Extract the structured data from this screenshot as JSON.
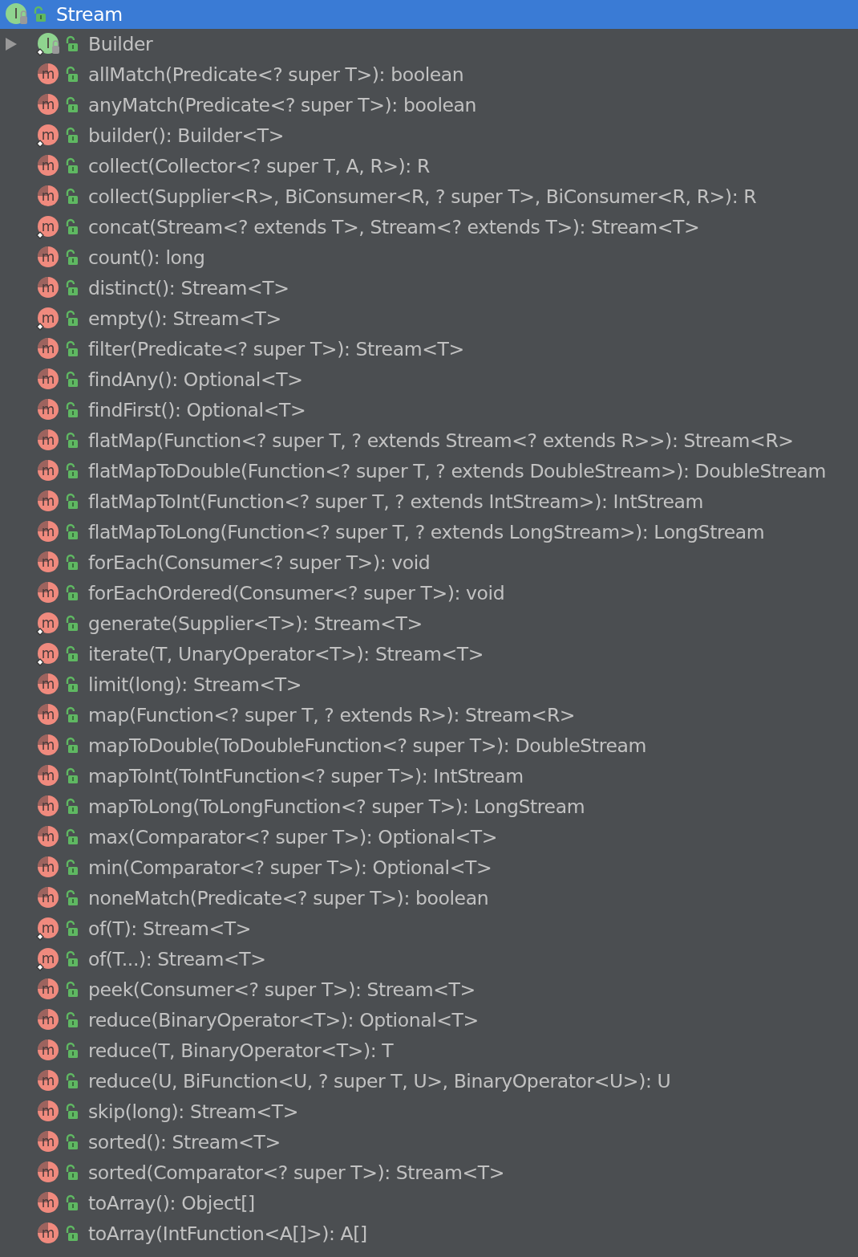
{
  "tree": {
    "label": "Stream",
    "kind": "interface",
    "icon_letter": "I",
    "static": false,
    "abstract": false,
    "selected": true,
    "children": [
      {
        "label": "Builder",
        "kind": "interface",
        "icon_letter": "I",
        "static": true,
        "abstract": false,
        "selected": false,
        "expanded": false
      },
      {
        "label": "allMatch(Predicate<? super T>): boolean",
        "kind": "method",
        "icon_letter": "m",
        "static": false,
        "abstract": true,
        "selected": false
      },
      {
        "label": "anyMatch(Predicate<? super T>): boolean",
        "kind": "method",
        "icon_letter": "m",
        "static": false,
        "abstract": true,
        "selected": false
      },
      {
        "label": "builder(): Builder<T>",
        "kind": "method",
        "icon_letter": "m",
        "static": true,
        "abstract": false,
        "selected": false
      },
      {
        "label": "collect(Collector<? super T, A, R>): R",
        "kind": "method",
        "icon_letter": "m",
        "static": false,
        "abstract": true,
        "selected": false
      },
      {
        "label": "collect(Supplier<R>, BiConsumer<R, ? super T>, BiConsumer<R, R>): R",
        "kind": "method",
        "icon_letter": "m",
        "static": false,
        "abstract": true,
        "selected": false
      },
      {
        "label": "concat(Stream<? extends T>, Stream<? extends T>): Stream<T>",
        "kind": "method",
        "icon_letter": "m",
        "static": true,
        "abstract": false,
        "selected": false
      },
      {
        "label": "count(): long",
        "kind": "method",
        "icon_letter": "m",
        "static": false,
        "abstract": true,
        "selected": false
      },
      {
        "label": "distinct(): Stream<T>",
        "kind": "method",
        "icon_letter": "m",
        "static": false,
        "abstract": true,
        "selected": false
      },
      {
        "label": "empty(): Stream<T>",
        "kind": "method",
        "icon_letter": "m",
        "static": true,
        "abstract": false,
        "selected": false
      },
      {
        "label": "filter(Predicate<? super T>): Stream<T>",
        "kind": "method",
        "icon_letter": "m",
        "static": false,
        "abstract": true,
        "selected": false
      },
      {
        "label": "findAny(): Optional<T>",
        "kind": "method",
        "icon_letter": "m",
        "static": false,
        "abstract": true,
        "selected": false
      },
      {
        "label": "findFirst(): Optional<T>",
        "kind": "method",
        "icon_letter": "m",
        "static": false,
        "abstract": true,
        "selected": false
      },
      {
        "label": "flatMap(Function<? super T, ? extends Stream<? extends R>>): Stream<R>",
        "kind": "method",
        "icon_letter": "m",
        "static": false,
        "abstract": true,
        "selected": false
      },
      {
        "label": "flatMapToDouble(Function<? super T, ? extends DoubleStream>): DoubleStream",
        "kind": "method",
        "icon_letter": "m",
        "static": false,
        "abstract": true,
        "selected": false
      },
      {
        "label": "flatMapToInt(Function<? super T, ? extends IntStream>): IntStream",
        "kind": "method",
        "icon_letter": "m",
        "static": false,
        "abstract": true,
        "selected": false
      },
      {
        "label": "flatMapToLong(Function<? super T, ? extends LongStream>): LongStream",
        "kind": "method",
        "icon_letter": "m",
        "static": false,
        "abstract": true,
        "selected": false
      },
      {
        "label": "forEach(Consumer<? super T>): void",
        "kind": "method",
        "icon_letter": "m",
        "static": false,
        "abstract": true,
        "selected": false
      },
      {
        "label": "forEachOrdered(Consumer<? super T>): void",
        "kind": "method",
        "icon_letter": "m",
        "static": false,
        "abstract": true,
        "selected": false
      },
      {
        "label": "generate(Supplier<T>): Stream<T>",
        "kind": "method",
        "icon_letter": "m",
        "static": true,
        "abstract": false,
        "selected": false
      },
      {
        "label": "iterate(T, UnaryOperator<T>): Stream<T>",
        "kind": "method",
        "icon_letter": "m",
        "static": true,
        "abstract": false,
        "selected": false
      },
      {
        "label": "limit(long): Stream<T>",
        "kind": "method",
        "icon_letter": "m",
        "static": false,
        "abstract": true,
        "selected": false
      },
      {
        "label": "map(Function<? super T, ? extends R>): Stream<R>",
        "kind": "method",
        "icon_letter": "m",
        "static": false,
        "abstract": true,
        "selected": false
      },
      {
        "label": "mapToDouble(ToDoubleFunction<? super T>): DoubleStream",
        "kind": "method",
        "icon_letter": "m",
        "static": false,
        "abstract": true,
        "selected": false
      },
      {
        "label": "mapToInt(ToIntFunction<? super T>): IntStream",
        "kind": "method",
        "icon_letter": "m",
        "static": false,
        "abstract": true,
        "selected": false
      },
      {
        "label": "mapToLong(ToLongFunction<? super T>): LongStream",
        "kind": "method",
        "icon_letter": "m",
        "static": false,
        "abstract": true,
        "selected": false
      },
      {
        "label": "max(Comparator<? super T>): Optional<T>",
        "kind": "method",
        "icon_letter": "m",
        "static": false,
        "abstract": true,
        "selected": false
      },
      {
        "label": "min(Comparator<? super T>): Optional<T>",
        "kind": "method",
        "icon_letter": "m",
        "static": false,
        "abstract": true,
        "selected": false
      },
      {
        "label": "noneMatch(Predicate<? super T>): boolean",
        "kind": "method",
        "icon_letter": "m",
        "static": false,
        "abstract": true,
        "selected": false
      },
      {
        "label": "of(T): Stream<T>",
        "kind": "method",
        "icon_letter": "m",
        "static": true,
        "abstract": false,
        "selected": false
      },
      {
        "label": "of(T...): Stream<T>",
        "kind": "method",
        "icon_letter": "m",
        "static": true,
        "abstract": false,
        "selected": false
      },
      {
        "label": "peek(Consumer<? super T>): Stream<T>",
        "kind": "method",
        "icon_letter": "m",
        "static": false,
        "abstract": true,
        "selected": false
      },
      {
        "label": "reduce(BinaryOperator<T>): Optional<T>",
        "kind": "method",
        "icon_letter": "m",
        "static": false,
        "abstract": true,
        "selected": false
      },
      {
        "label": "reduce(T, BinaryOperator<T>): T",
        "kind": "method",
        "icon_letter": "m",
        "static": false,
        "abstract": true,
        "selected": false
      },
      {
        "label": "reduce(U, BiFunction<U, ? super T, U>, BinaryOperator<U>): U",
        "kind": "method",
        "icon_letter": "m",
        "static": false,
        "abstract": true,
        "selected": false
      },
      {
        "label": "skip(long): Stream<T>",
        "kind": "method",
        "icon_letter": "m",
        "static": false,
        "abstract": true,
        "selected": false
      },
      {
        "label": "sorted(): Stream<T>",
        "kind": "method",
        "icon_letter": "m",
        "static": false,
        "abstract": true,
        "selected": false
      },
      {
        "label": "sorted(Comparator<? super T>): Stream<T>",
        "kind": "method",
        "icon_letter": "m",
        "static": false,
        "abstract": true,
        "selected": false
      },
      {
        "label": "toArray(): Object[]",
        "kind": "method",
        "icon_letter": "m",
        "static": false,
        "abstract": true,
        "selected": false
      },
      {
        "label": "toArray(IntFunction<A[]>): A[]",
        "kind": "method",
        "icon_letter": "m",
        "static": false,
        "abstract": true,
        "selected": false
      }
    ]
  }
}
